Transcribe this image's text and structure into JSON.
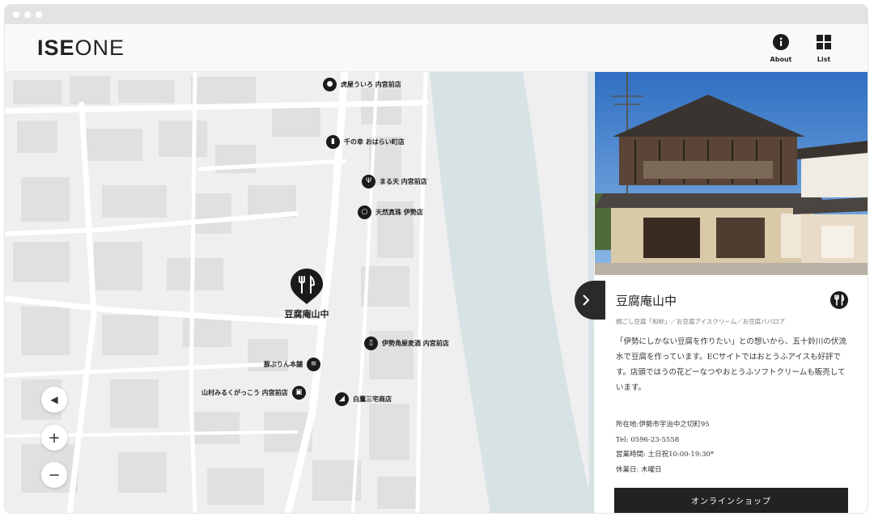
{
  "app": {
    "logo_bold": "ISE",
    "logo_light": "ONE"
  },
  "header": {
    "about_label": "About",
    "list_label": "List",
    "about_icon": "info-icon",
    "list_icon": "grid-icon"
  },
  "map": {
    "pins": [
      {
        "label": "虎屋ういろ 内宮前店",
        "icon": "sweets-icon"
      },
      {
        "label": "千の幸 おはらい町店",
        "icon": "bottle-icon"
      },
      {
        "label": "まる天 内宮前店",
        "icon": "restaurant-icon"
      },
      {
        "label": "天然真珠 伊勢店",
        "icon": "pearl-icon"
      },
      {
        "label": "伊勢角屋麦酒 内宮前店",
        "icon": "beer-icon"
      },
      {
        "label": "豚ぷりん本舗",
        "icon": "burger-icon"
      },
      {
        "label": "山村みるくがっこう 内宮前店",
        "icon": "milk-icon"
      },
      {
        "label": "白鷹三宅商店",
        "icon": "sake-icon"
      }
    ],
    "selected_pin": {
      "label": "豆腐庵山中",
      "icon": "restaurant-icon"
    },
    "controls": {
      "locate": "◀",
      "zoom_in": "+",
      "zoom_out": "−"
    }
  },
  "detail": {
    "title": "豆腐庵山中",
    "category_icon": "restaurant-icon",
    "subtitle": "絹ごし豆腐「和紗」／お豆腐アイスクリーム／お豆腐ババロア",
    "description": "「伊勢にしかない豆腐を作りたい」との想いから、五十鈴川の伏流水で豆腐を作っています。ECサイトではおとうふアイスも好評です。店頭ではうの花どーなつやおとうふソフトクリームも販売しています。",
    "address": "所在地:伊勢市宇治中之切町95",
    "tel": "Tel: 0596-23-5558",
    "hours": "営業時間: 土日祝10:00-19:30*",
    "closed": "休業日: 木曜日",
    "shop_button": "オンラインショップ",
    "toggle_icon": "chevron-right-icon"
  }
}
